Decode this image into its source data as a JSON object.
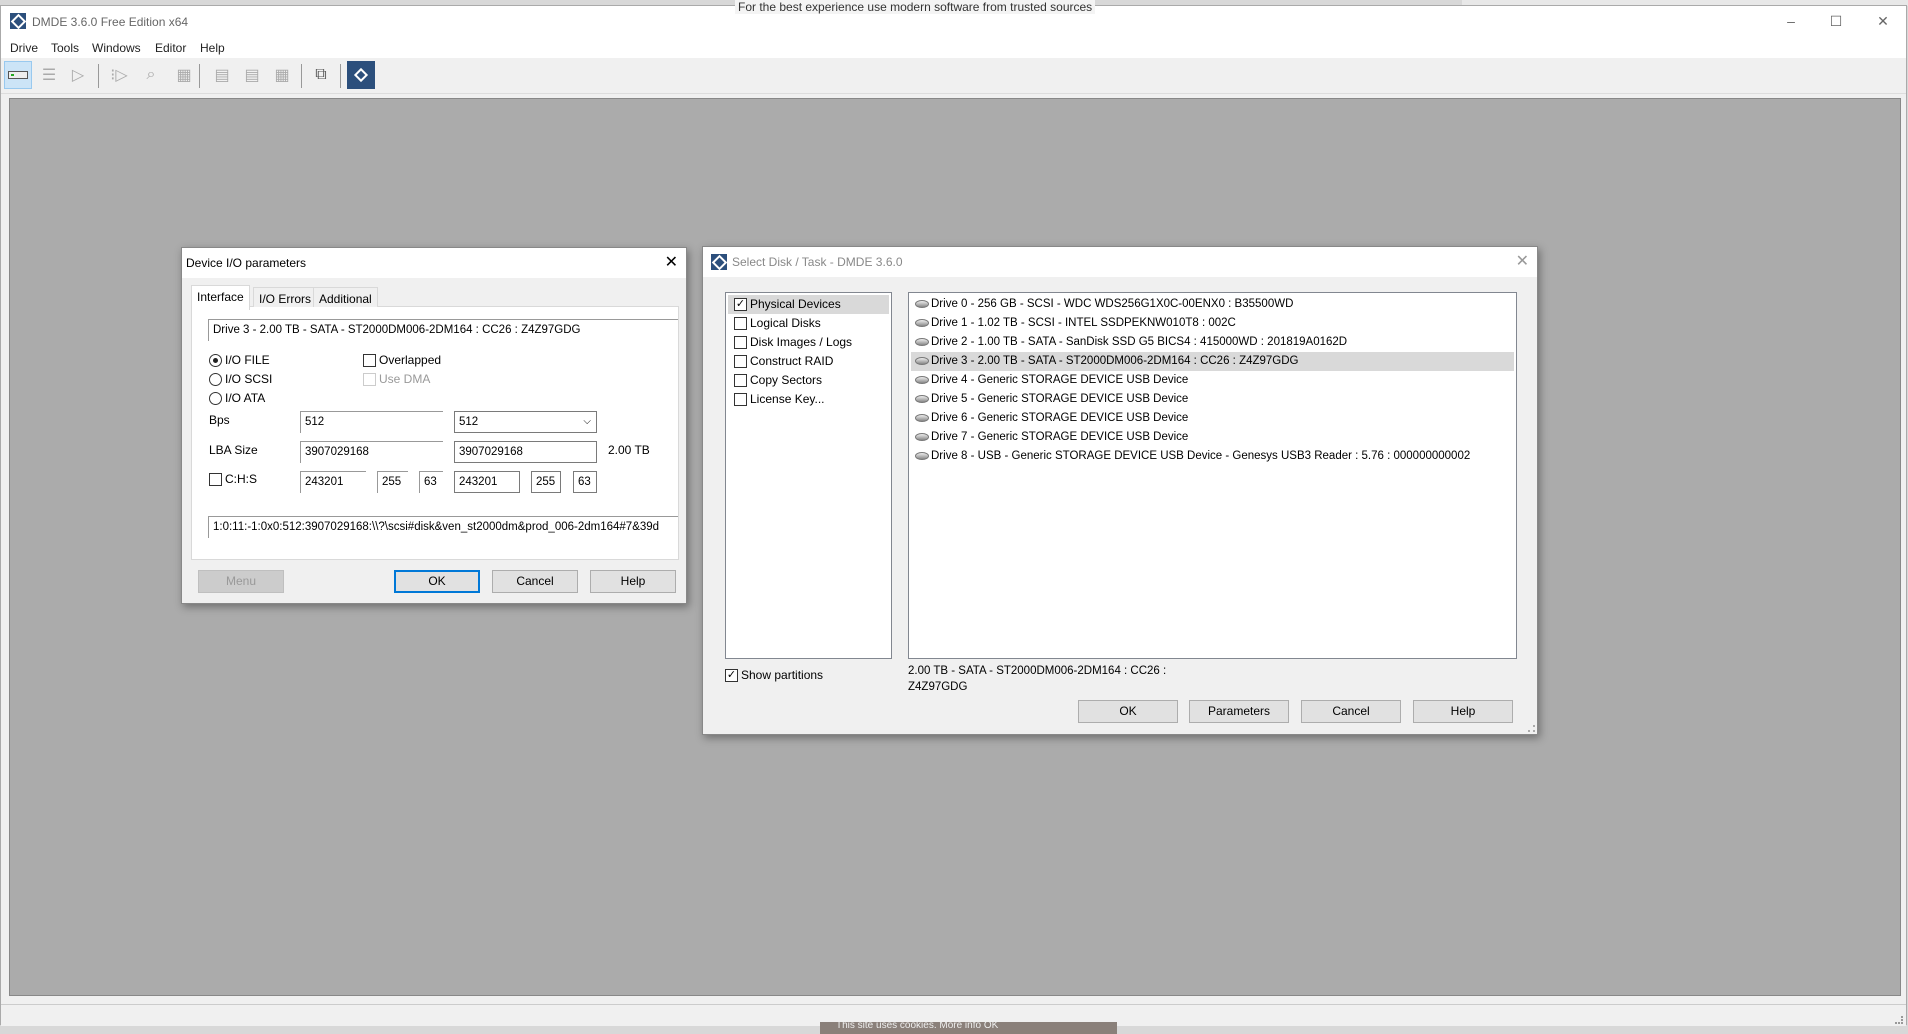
{
  "background": {
    "notice_text": "For the best experience use modern software from trusted sources",
    "cookie_text": "This site uses cookies. More info  OK"
  },
  "app": {
    "title": "DMDE 3.6.0 Free Edition x64",
    "window_controls": {
      "minimize": "–",
      "maximize": "☐",
      "close": "✕"
    }
  },
  "menu": [
    "Drive",
    "Tools",
    "Windows",
    "Editor",
    "Help"
  ],
  "toolbar": {
    "icons": [
      "open-drive-icon",
      "partitions-icon",
      "go-icon",
      "navigate-icon",
      "search-icon",
      "new-file-icon",
      "tree-view-icon",
      "list-view-icon",
      "grid-view-icon",
      "recover-icon",
      "dmde-logo-icon"
    ],
    "active": "open-drive-icon"
  },
  "io_dialog": {
    "title": "Device I/O parameters",
    "tabs": [
      "Interface",
      "I/O Errors",
      "Additional"
    ],
    "selected_tab": "Interface",
    "device": "Drive 3 - 2.00 TB - SATA - ST2000DM006-2DM164 : CC26 : Z4Z97GDG",
    "io_modes": [
      {
        "label": "I/O FILE",
        "selected": true
      },
      {
        "label": "I/O SCSI",
        "selected": false
      },
      {
        "label": "I/O ATA",
        "selected": false
      }
    ],
    "overlapped": {
      "label": "Overlapped",
      "checked": false
    },
    "use_dma": {
      "label": "Use DMA",
      "checked": false,
      "enabled": false
    },
    "bps": {
      "label": "Bps",
      "value": "512",
      "select": "512"
    },
    "lba": {
      "label": "LBA Size",
      "value": "3907029168",
      "value2": "3907029168",
      "size": "2.00 TB"
    },
    "chs": {
      "label": "C:H:S",
      "checked": false,
      "c": "243201",
      "h": "255",
      "s": "63",
      "c2": "243201",
      "h2": "255",
      "s2": "63"
    },
    "path": "1:0:11:-1:0x0:512:3907029168:\\\\?\\scsi#disk&ven_st2000dm&prod_006-2dm164#7&39d",
    "buttons": {
      "menu": "Menu",
      "ok": "OK",
      "cancel": "Cancel",
      "help": "Help"
    }
  },
  "select_dialog": {
    "title": "Select Disk / Task - DMDE 3.6.0",
    "tasks": [
      {
        "label": "Physical Devices",
        "checked": true,
        "selected": true
      },
      {
        "label": "Logical Disks",
        "checked": false
      },
      {
        "label": "Disk Images / Logs",
        "checked": false
      },
      {
        "label": "Construct RAID",
        "checked": false
      },
      {
        "label": "Copy Sectors",
        "checked": false
      },
      {
        "label": "License Key...",
        "checked": false
      }
    ],
    "drives": [
      "Drive 0 - 256 GB - SCSI - WDC WDS256G1X0C-00ENX0 : B35500WD",
      "Drive 1 - 1.02 TB - SCSI - INTEL SSDPEKNW010T8 : 002C",
      "Drive 2 - 1.00 TB - SATA - SanDisk SSD G5 BICS4 : 415000WD : 201819A0162D",
      "Drive 3 - 2.00 TB - SATA - ST2000DM006-2DM164 : CC26 : Z4Z97GDG",
      "Drive 4 - Generic STORAGE DEVICE USB Device",
      "Drive 5 - Generic STORAGE DEVICE USB Device",
      "Drive 6 - Generic STORAGE DEVICE USB Device",
      "Drive 7 - Generic STORAGE DEVICE USB Device",
      "Drive 8 - USB - Generic STORAGE DEVICE USB Device - Genesys  USB3 Reader  : 5.76 : 000000000002"
    ],
    "selected_drive_index": 3,
    "show_partitions": {
      "label": "Show partitions",
      "checked": true
    },
    "info_line1": "2.00 TB - SATA - ST2000DM006-2DM164 : CC26 :",
    "info_line2": "Z4Z97GDG",
    "buttons": {
      "ok": "OK",
      "parameters": "Parameters",
      "cancel": "Cancel",
      "help": "Help"
    }
  }
}
